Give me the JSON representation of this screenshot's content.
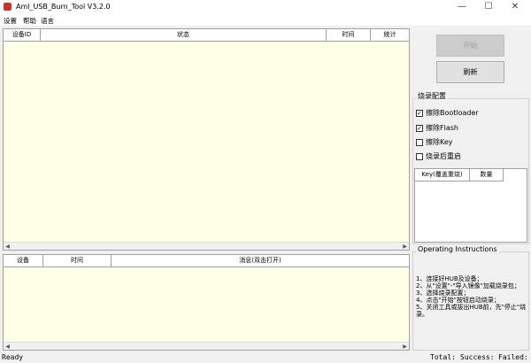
{
  "window": {
    "title": "Aml_USB_Burn_Tool V3.2.0",
    "minimize": "—",
    "maximize": "☐",
    "close": "✕"
  },
  "menu": {
    "items": [
      "设置",
      "帮助",
      "语言"
    ]
  },
  "device_table": {
    "columns": [
      "设备ID",
      "状态",
      "时间",
      "统计"
    ]
  },
  "log_table": {
    "columns": [
      "设备",
      "时间",
      "消息(双击打开)"
    ]
  },
  "buttons": {
    "start": "开始",
    "refresh": "刷新"
  },
  "burn_config": {
    "label": "烧录配置",
    "options": [
      {
        "label": "擦除Bootloader",
        "checked": true
      },
      {
        "label": "擦除Flash",
        "checked": true
      },
      {
        "label": "擦除Key",
        "checked": false
      },
      {
        "label": "烧录后重启",
        "checked": false
      }
    ]
  },
  "key_table": {
    "columns": [
      "Key(覆盖重烧)",
      "数量"
    ]
  },
  "instructions": {
    "label": "Operating Instructions",
    "lines": [
      "1、连接好HUB及设备；",
      "2、从\"设置\"-\"导入镜像\"加载烧录包；",
      "3、选择烧录配置；",
      "4、点击\"开始\"按钮启动烧录；",
      "5、关闭工具或拔出HUB前，先\"停止\"烧录。"
    ]
  },
  "status": {
    "left": "Ready",
    "total": "Total:",
    "success": "Success:",
    "failed": "Failed:"
  }
}
